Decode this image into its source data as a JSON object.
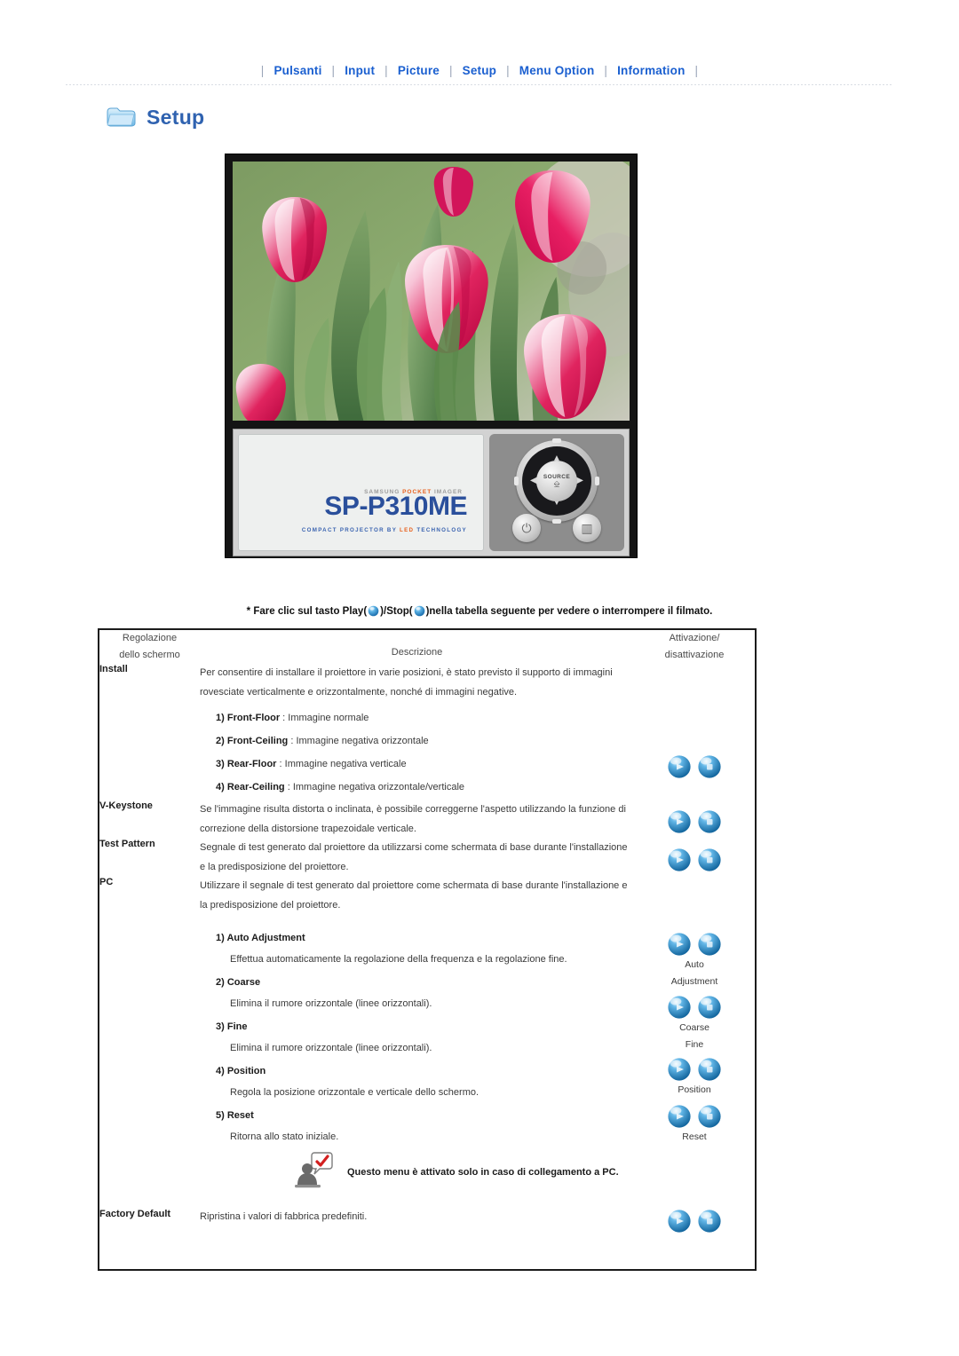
{
  "nav": {
    "separator": "|",
    "items": [
      {
        "label": "Pulsanti",
        "name": "nav-pulsanti"
      },
      {
        "label": "Input",
        "name": "nav-input"
      },
      {
        "label": "Picture",
        "name": "nav-picture"
      },
      {
        "label": "Setup",
        "name": "nav-setup"
      },
      {
        "label": "Menu Option",
        "name": "nav-menu-option"
      },
      {
        "label": "Information",
        "name": "nav-information"
      }
    ],
    "link_color": "#1a5fd0"
  },
  "section": {
    "title": "Setup",
    "icon": "folder-icon",
    "title_color": "#2f62b0"
  },
  "device": {
    "screen_image": "tulips-photo",
    "brand_prefix": "SAMSUNG ",
    "brand_pocket": "POCKET",
    "brand_suffix": " IMAGER",
    "model": "SP-P310ME",
    "tagline_1": "COMPACT PROJECTOR BY ",
    "tagline_led": "LED",
    "tagline_2": " TECHNOLOGY",
    "source_label": "SOURCE",
    "power_glyph": "⏻",
    "menu_glyph": "▥"
  },
  "note": {
    "prefix": "* Fare clic sul tasto Play(",
    "middle": ")/Stop(",
    "suffix": ")nella tabella seguente per vedere o interrompere il filmato."
  },
  "table": {
    "headers": {
      "col1_line1": "Regolazione",
      "col1_line2": "dello schermo",
      "col2": "Descrizione",
      "col3_line1": "Attivazione/",
      "col3_line2": "disattivazione"
    },
    "rows": {
      "install": {
        "label": "Install",
        "intro": "Per consentire di installare il proiettore in varie posizioni, è stato previsto il supporto di immagini rovesciate verticalmente e orizzontalmente, nonché di immagini negative.",
        "items": [
          {
            "num": "1)",
            "term": "Front-Floor",
            "sep": " : ",
            "desc": "Immagine normale"
          },
          {
            "num": "2)",
            "term": "Front-Ceiling",
            "sep": " : ",
            "desc": "Immagine negativa orizzontale"
          },
          {
            "num": "3)",
            "term": "Rear-Floor",
            "sep": " : ",
            "desc": "Immagine negativa verticale"
          },
          {
            "num": "4)",
            "term": "Rear-Ceiling",
            "sep": " : ",
            "desc": "Immagine negativa orizzontale/verticale"
          }
        ]
      },
      "vkeystone": {
        "label": "V-Keystone",
        "desc": "Se l'immagine risulta distorta o inclinata, è possibile correggerne l'aspetto utilizzando la funzione di correzione della distorsione trapezoidale verticale."
      },
      "testpattern": {
        "label": "Test Pattern",
        "desc": "Segnale di test generato dal proiettore da utilizzarsi come schermata di base durante l'installazione e la predisposizione del proiettore."
      },
      "pc": {
        "label": "PC",
        "desc": "Utilizzare il segnale di test generato dal proiettore come schermata di base durante l'installazione e la predisposizione del proiettore.",
        "items": [
          {
            "num": "1)",
            "term": "Auto Adjustment",
            "desc": "Effettua automaticamente la regolazione della frequenza e la regolazione fine."
          },
          {
            "num": "2)",
            "term": "Coarse",
            "desc": "Elimina il rumore orizzontale (linee orizzontali)."
          },
          {
            "num": "3)",
            "term": "Fine",
            "desc": "Elimina il rumore orizzontale (linee orizzontali)."
          },
          {
            "num": "4)",
            "term": "Position",
            "desc": "Regola la posizione orizzontale e verticale dello schermo."
          },
          {
            "num": "5)",
            "term": "Reset",
            "desc": "Ritorna allo stato iniziale."
          }
        ],
        "controls": [
          {
            "caption_line1": "Auto",
            "caption_line2": "Adjustment"
          },
          {
            "caption_line1": "Coarse",
            "caption_line2": "Fine"
          },
          {
            "caption_line1": "Position",
            "caption_line2": ""
          },
          {
            "caption_line1": "Reset",
            "caption_line2": ""
          }
        ]
      },
      "memo": {
        "icon": "memo-person-icon",
        "text": "Questo menu è attivato solo in caso di collegamento a PC."
      },
      "factorydefault": {
        "label": "Factory Default",
        "desc": "Ripristina i valori di fabbrica predefiniti."
      }
    },
    "buttons": {
      "play": "play-ball-button",
      "stop": "stop-ball-button"
    },
    "border_color": "#1b1b1b"
  }
}
